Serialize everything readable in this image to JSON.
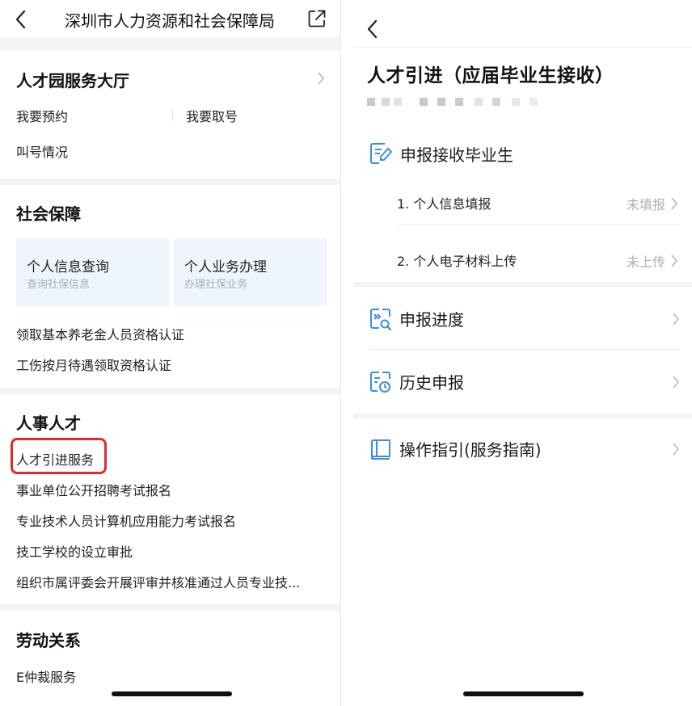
{
  "left": {
    "header": {
      "title": "深圳市人力资源和社会保障局"
    },
    "talent_hall": {
      "title": "人才园服务大厅",
      "items": [
        "我要预约",
        "我要取号",
        "叫号情况"
      ]
    },
    "social_security": {
      "title": "社会保障",
      "cards": [
        {
          "title": "个人信息查询",
          "subtitle": "查询社保信息"
        },
        {
          "title": "个人业务办理",
          "subtitle": "办理社保业务"
        }
      ],
      "items": [
        "领取基本养老金人员资格认证",
        "工伤按月待遇领取资格认证"
      ]
    },
    "hr_talent": {
      "title": "人事人才",
      "items": [
        "人才引进服务",
        "事业单位公开招聘考试报名",
        "专业技术人员计算机应用能力考试报名",
        "技工学校的设立审批",
        "组织市属评委会开展评审并核准通过人员专业技..."
      ]
    },
    "labor": {
      "title": "劳动关系",
      "items": [
        "E仲裁服务"
      ]
    }
  },
  "right": {
    "title": "人才引进（应届毕业生接收）",
    "sections": {
      "apply": {
        "label": "申报接收毕业生",
        "steps": [
          {
            "label": "1. 个人信息填报",
            "status": "未填报"
          },
          {
            "label": "2. 个人电子材料上传",
            "status": "未上传"
          }
        ]
      },
      "progress": {
        "label": "申报进度"
      },
      "history": {
        "label": "历史申报"
      },
      "guide": {
        "label": "操作指引(服务指南)"
      }
    }
  },
  "colors": {
    "accent_icon": "#3a8ee6",
    "highlight": "#e02b2b",
    "card_bg": "#eef5fb"
  }
}
